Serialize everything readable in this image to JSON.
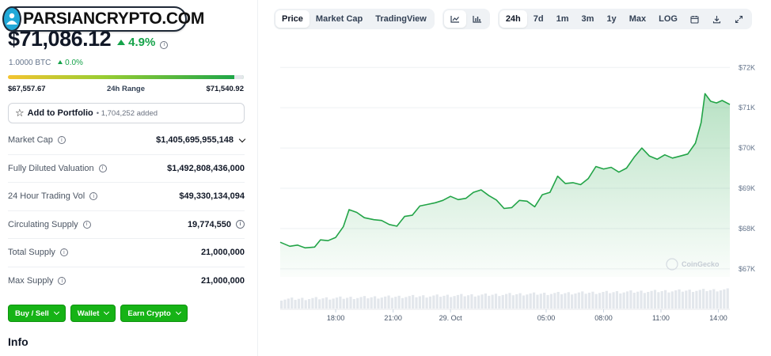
{
  "watermark": {
    "text": "PARSIANCRYPTO.COM"
  },
  "coin": {
    "price": "$71,086.12",
    "change_pct": "4.9%",
    "btc_value": "1.0000 BTC",
    "btc_change": "0.0%",
    "range_low": "$67,557.67",
    "range_label": "24h Range",
    "range_high": "$71,540.92",
    "range_position": 0.96
  },
  "portfolio": {
    "label": "Add to Portfolio",
    "added": "• 1,704,252 added"
  },
  "stats": [
    {
      "key": "Market Cap",
      "value": "$1,405,695,955,148"
    },
    {
      "key": "Fully Diluted Valuation",
      "value": "$1,492,808,436,000"
    },
    {
      "key": "24 Hour Trading Vol",
      "value": "$49,330,134,094"
    },
    {
      "key": "Circulating Supply",
      "value": "19,774,550"
    },
    {
      "key": "Total Supply",
      "value": "21,000,000"
    },
    {
      "key": "Max Supply",
      "value": "21,000,000"
    }
  ],
  "actions": [
    "Buy / Sell",
    "Wallet",
    "Earn Crypto"
  ],
  "info_title": "Info",
  "toolbar": {
    "views": [
      "Price",
      "Market Cap",
      "TradingView"
    ],
    "active_view": "Price",
    "chart_icons": [
      "line-chart-icon",
      "bar-chart-icon"
    ],
    "ranges": [
      "24h",
      "7d",
      "1m",
      "3m",
      "1y",
      "Max",
      "LOG"
    ],
    "active_range": "24h",
    "tool_icons": [
      "calendar-icon",
      "download-icon",
      "expand-icon"
    ]
  },
  "chart_watermark": "CoinGecko",
  "colors": {
    "accent_green": "#16a34a",
    "button_green": "#16b316",
    "line": "#22a447"
  },
  "chart_data": {
    "type": "area",
    "title": "",
    "xlabel": "",
    "ylabel": "",
    "ylim": [
      66800,
      72300
    ],
    "yticks": [
      "$67K",
      "$68K",
      "$69K",
      "$70K",
      "$71K",
      "$72K"
    ],
    "ytick_values": [
      67000,
      68000,
      69000,
      70000,
      71000,
      72000
    ],
    "xticks": [
      "18:00",
      "21:00",
      "29. Oct",
      "05:00",
      "08:00",
      "11:00",
      "14:00"
    ],
    "xtick_hours": [
      18,
      21,
      24,
      29,
      32,
      35,
      38
    ],
    "x_start_hour": 15.1,
    "x_end_hour": 38.6,
    "x_hours": [
      15.1,
      15.6,
      16.0,
      16.4,
      16.9,
      17.2,
      17.6,
      18.0,
      18.4,
      18.7,
      19.1,
      19.5,
      20.0,
      20.4,
      20.8,
      21.2,
      21.6,
      22.0,
      22.4,
      22.8,
      23.2,
      23.6,
      24.0,
      24.4,
      24.8,
      25.2,
      25.6,
      26.0,
      26.4,
      26.8,
      27.2,
      27.6,
      28.0,
      28.4,
      28.8,
      29.2,
      29.6,
      30.0,
      30.4,
      30.8,
      31.2,
      31.6,
      32.0,
      32.4,
      32.8,
      33.2,
      33.6,
      34.0,
      34.4,
      34.8,
      35.2,
      35.6,
      36.0,
      36.4,
      36.8,
      37.1,
      37.3,
      37.6,
      37.9,
      38.2,
      38.6
    ],
    "series": [
      {
        "values": [
          67660,
          67560,
          67590,
          67520,
          67540,
          67720,
          67700,
          67780,
          68050,
          68470,
          68400,
          68270,
          68220,
          68200,
          68100,
          68060,
          68300,
          68330,
          68560,
          68600,
          68640,
          68700,
          68800,
          68720,
          68750,
          68900,
          68960,
          68820,
          68710,
          68500,
          68520,
          68700,
          68680,
          68540,
          68840,
          68900,
          69300,
          69120,
          69140,
          69090,
          69240,
          69540,
          69480,
          69520,
          69400,
          69500,
          69770,
          70000,
          69800,
          69720,
          69830,
          69750,
          69800,
          69850,
          70120,
          70630,
          71350,
          71160,
          71120,
          71180,
          71080
        ]
      }
    ],
    "volume_bars": true,
    "grid": true
  }
}
